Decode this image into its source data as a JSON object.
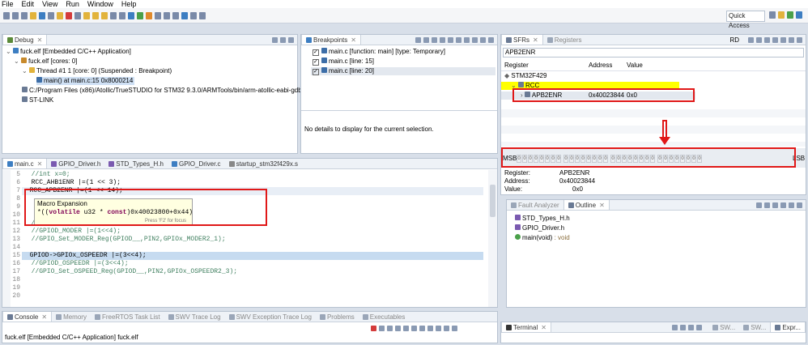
{
  "menu": [
    "File",
    "Edit",
    "View",
    "Run",
    "Window",
    "Help"
  ],
  "quick_access": "Quick Access",
  "debug": {
    "tab": "Debug",
    "tree": [
      "fuck.elf [Embedded C/C++ Application]",
      "fuck.elf [cores: 0]",
      "Thread #1 1 [core: 0] (Suspended : Breakpoint)",
      "main() at main.c:15 0x8000214",
      "C:/Program Files (x86)/Atollic/TrueSTUDIO for STM32 9.3.0/ARMTools/bin/arm-atollic-eabi-gdb",
      "ST-LINK"
    ]
  },
  "breakpoints": {
    "tab": "Breakpoints",
    "items": [
      "main.c [function: main] [type: Temporary]",
      "main.c [line: 15]",
      "main.c [line: 20]"
    ],
    "detail": "No details to display for the current selection."
  },
  "sfrs": {
    "tab": "SFRs",
    "tab2": "Registers",
    "rd": "RD",
    "search": "APB2ENR",
    "cols": [
      "Register",
      "Address",
      "Value"
    ],
    "device": "STM32F429",
    "group": "RCC",
    "reg_name": "APB2ENR",
    "reg_addr": "0x40023844",
    "reg_val": "0x0",
    "bits_msb": "MSB",
    "bits_lsb": "LSB",
    "bit_value": "0",
    "info": {
      "register_label": "Register:",
      "register": "APB2ENR",
      "address_label": "Address:",
      "address": "0x40023844",
      "value_label": "Value:",
      "value": "0x0"
    }
  },
  "editor": {
    "tabs": [
      "main.c",
      "GPIO_Driver.h",
      "STD_Types_H.h",
      "GPIO_Driver.c",
      "startup_stm32f429x.s"
    ],
    "lines": [
      {
        "n": "5",
        "t": "  //int x=0;"
      },
      {
        "n": "6",
        "t": "  RCC_AHB1ENR |=(1 << 3);"
      },
      {
        "n": "7",
        "t": "  RCC_APB2ENR |=(1 << 14);"
      },
      {
        "n": "8",
        "t": ""
      },
      {
        "n": "9",
        "t": ""
      },
      {
        "n": "10",
        "t": ""
      },
      {
        "n": "11",
        "t": "  //GPIO_MODER |=(1<<4);"
      },
      {
        "n": "12",
        "t": "  //GPIOD_MODER |=(1<<4);"
      },
      {
        "n": "13",
        "t": "  //GPIO_Set_MODER_Reg(GPIOD__,PIN2,GPIOx_MODER2_1);"
      },
      {
        "n": "14",
        "t": ""
      },
      {
        "n": "15",
        "t": "  GPIOD->GPIOx_OSPEEDR |=(3<<4);"
      },
      {
        "n": "16",
        "t": "  //GPIOD_OSPEEDR |=(3<<4);"
      },
      {
        "n": "17",
        "t": "  //GPIO_Set_OSPEED_Reg(GPIOD__,PIN2,GPIOx_OSPEEDR2_3);"
      },
      {
        "n": "18",
        "t": ""
      },
      {
        "n": "19",
        "t": ""
      },
      {
        "n": "20",
        "t": ""
      }
    ],
    "popup": {
      "title": "Macro Expansion",
      "kw1": "volatile",
      "ty": "u32",
      "kw2": "const",
      "pre": "*((",
      "mid1": " ",
      "mid2": " * ",
      "post": ")0x40023800+0x44)",
      "hint": "Press 'F2' for focus"
    }
  },
  "outline": {
    "tab_fault": "Fault Analyzer",
    "tab": "Outline",
    "items": [
      "STD_Types_H.h",
      "GPIO_Driver.h",
      "main(void)"
    ],
    "main_type": ": void"
  },
  "console": {
    "tabs": [
      "Console",
      "Memory",
      "FreeRTOS Task List",
      "SWV Trace Log",
      "SWV Exception Trace Log",
      "Problems",
      "Executables"
    ],
    "text": "fuck.elf [Embedded C/C++ Application] fuck.elf"
  },
  "terminal": {
    "tab": "Terminal",
    "tabs_right": [
      "SW...",
      "SW...",
      "Expr..."
    ]
  }
}
